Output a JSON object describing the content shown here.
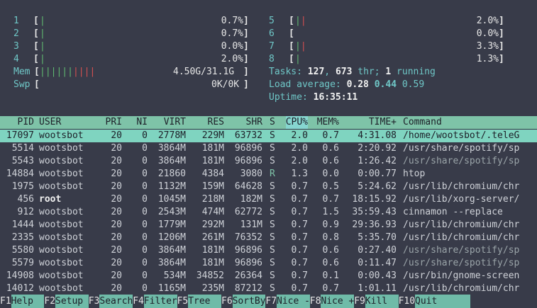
{
  "cpus_left": [
    {
      "num": "1",
      "bar": "|",
      "pct": "0.7%"
    },
    {
      "num": "2",
      "bar": "|",
      "pct": "0.7%"
    },
    {
      "num": "3",
      "bar": "|",
      "pct": "0.0%"
    },
    {
      "num": "4",
      "bar": "|",
      "pct": "2.0%"
    }
  ],
  "cpus_right": [
    {
      "num": "5",
      "bar": "||",
      "pct": "2.0%"
    },
    {
      "num": "6",
      "bar": "",
      "pct": "0.0%"
    },
    {
      "num": "7",
      "bar": "||",
      "pct": "3.3%"
    },
    {
      "num": "8",
      "bar": "|",
      "pct": "1.3%"
    }
  ],
  "mem": {
    "label": "Mem",
    "bar_green": "||||||",
    "bar_red": "||||",
    "value": "4.50G/31.1G"
  },
  "swp": {
    "label": "Swp",
    "value": "0K/0K"
  },
  "tasks": {
    "label": "Tasks:",
    "count": "127",
    "sep1": ",",
    "thr": "673",
    "thr_label": "thr;",
    "running": "1",
    "running_label": "running"
  },
  "load": {
    "label": "Load average:",
    "l1": "0.28",
    "l5": "0.44",
    "l15": "0.59"
  },
  "uptime": {
    "label": "Uptime:",
    "value": "16:35:11"
  },
  "columns": [
    "PID",
    "USER",
    "PRI",
    "NI",
    "VIRT",
    "RES",
    "SHR",
    "S",
    "CPU%",
    "MEM%",
    "TIME+",
    "Command"
  ],
  "processes": [
    {
      "pid": "17097",
      "user": "wootsbot",
      "pri": "20",
      "ni": "0",
      "virt": "2778M",
      "res": "229M",
      "shr": "63732",
      "s": "S",
      "cpu": "2.0",
      "mem": "0.7",
      "time": "4:31.08",
      "cmd": "/home/wootsbot/.teleG",
      "selected": true
    },
    {
      "pid": "5514",
      "user": "wootsbot",
      "pri": "20",
      "ni": "0",
      "virt": "3864M",
      "res": "181M",
      "shr": "96896",
      "s": "S",
      "cpu": "2.0",
      "mem": "0.6",
      "time": "2:20.92",
      "cmd": "/usr/share/spotify/sp"
    },
    {
      "pid": "5543",
      "user": "wootsbot",
      "pri": "20",
      "ni": "0",
      "virt": "3864M",
      "res": "181M",
      "shr": "96896",
      "s": "S",
      "cpu": "2.0",
      "mem": "0.6",
      "time": "1:26.42",
      "cmd": "/usr/share/spotify/sp",
      "dim": true
    },
    {
      "pid": "14884",
      "user": "wootsbot",
      "pri": "20",
      "ni": "0",
      "virt": "21860",
      "res": "4384",
      "shr": "3080",
      "s": "R",
      "cpu": "1.3",
      "mem": "0.0",
      "time": "0:00.77",
      "cmd": "htop"
    },
    {
      "pid": "1975",
      "user": "wootsbot",
      "pri": "20",
      "ni": "0",
      "virt": "1132M",
      "res": "159M",
      "shr": "64628",
      "s": "S",
      "cpu": "0.7",
      "mem": "0.5",
      "time": "5:24.62",
      "cmd": "/usr/lib/chromium/chr"
    },
    {
      "pid": "456",
      "user": "root",
      "pri": "20",
      "ni": "0",
      "virt": "1045M",
      "res": "218M",
      "shr": "182M",
      "s": "S",
      "cpu": "0.7",
      "mem": "0.7",
      "time": "18:15.92",
      "cmd": "/usr/lib/xorg-server/",
      "root": true
    },
    {
      "pid": "912",
      "user": "wootsbot",
      "pri": "20",
      "ni": "0",
      "virt": "2543M",
      "res": "474M",
      "shr": "62772",
      "s": "S",
      "cpu": "0.7",
      "mem": "1.5",
      "time": "35:59.43",
      "cmd": "cinnamon --replace"
    },
    {
      "pid": "1444",
      "user": "wootsbot",
      "pri": "20",
      "ni": "0",
      "virt": "1779M",
      "res": "292M",
      "shr": "131M",
      "s": "S",
      "cpu": "0.7",
      "mem": "0.9",
      "time": "29:36.93",
      "cmd": "/usr/lib/chromium/chr"
    },
    {
      "pid": "2335",
      "user": "wootsbot",
      "pri": "20",
      "ni": "0",
      "virt": "1206M",
      "res": "261M",
      "shr": "76352",
      "s": "S",
      "cpu": "0.7",
      "mem": "0.8",
      "time": "5:35.70",
      "cmd": "/usr/lib/chromium/chr"
    },
    {
      "pid": "5580",
      "user": "wootsbot",
      "pri": "20",
      "ni": "0",
      "virt": "3864M",
      "res": "181M",
      "shr": "96896",
      "s": "S",
      "cpu": "0.7",
      "mem": "0.6",
      "time": "0:27.40",
      "cmd": "/usr/share/spotify/sp",
      "dim": true
    },
    {
      "pid": "5579",
      "user": "wootsbot",
      "pri": "20",
      "ni": "0",
      "virt": "3864M",
      "res": "181M",
      "shr": "96896",
      "s": "S",
      "cpu": "0.7",
      "mem": "0.6",
      "time": "0:11.47",
      "cmd": "/usr/share/spotify/sp",
      "dim": true
    },
    {
      "pid": "14908",
      "user": "wootsbot",
      "pri": "20",
      "ni": "0",
      "virt": "534M",
      "res": "34852",
      "shr": "26364",
      "s": "S",
      "cpu": "0.7",
      "mem": "0.1",
      "time": "0:00.43",
      "cmd": "/usr/bin/gnome-screen"
    },
    {
      "pid": "14012",
      "user": "wootsbot",
      "pri": "20",
      "ni": "0",
      "virt": "1165M",
      "res": "235M",
      "shr": "87212",
      "s": "S",
      "cpu": "0.7",
      "mem": "0.7",
      "time": "1:01.11",
      "cmd": "/usr/lib/chromium/chr"
    }
  ],
  "footer": [
    {
      "key": "F1",
      "label": "Help  "
    },
    {
      "key": "F2",
      "label": "Setup "
    },
    {
      "key": "F3",
      "label": "Search"
    },
    {
      "key": "F4",
      "label": "Filter"
    },
    {
      "key": "F5",
      "label": "Tree  "
    },
    {
      "key": "F6",
      "label": "SortBy"
    },
    {
      "key": "F7",
      "label": "Nice -"
    },
    {
      "key": "F8",
      "label": "Nice +"
    },
    {
      "key": "F9",
      "label": "Kill  "
    },
    {
      "key": "F10",
      "label": "Quit      "
    }
  ],
  "colors": {
    "bg": "#383b49",
    "header_bg": "#7ec3a8",
    "selected_bg": "#7fd4c0",
    "accent": "#6fc7c7"
  }
}
